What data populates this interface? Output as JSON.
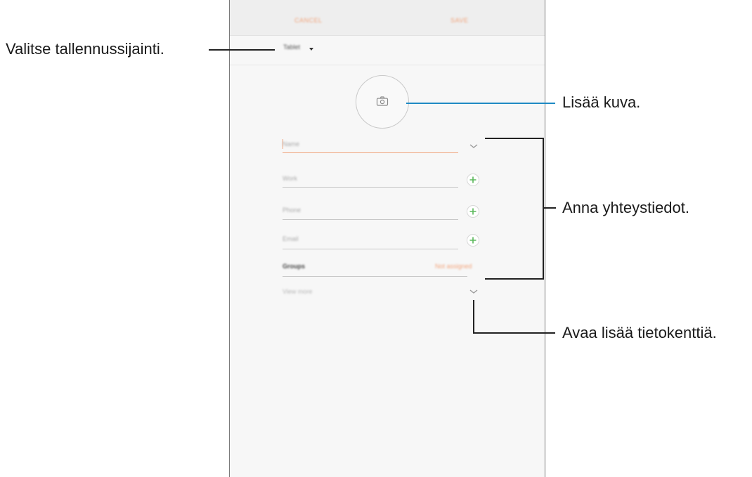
{
  "screen": {
    "top_bar": {
      "cancel_label": "CANCEL",
      "save_label": "SAVE"
    },
    "storage": {
      "label": "Tablet"
    },
    "fields": {
      "name_placeholder": "Name",
      "nickname_placeholder": "Work",
      "phone_placeholder": "Phone",
      "email_placeholder": "Email"
    },
    "groups": {
      "label": "Groups",
      "value": "Not assigned"
    },
    "view_more_label": "View more"
  },
  "callouts": {
    "storage": "Valitse tallennussijainti.",
    "photo": "Lisää kuva.",
    "details": "Anna yhteystiedot.",
    "more_fields": "Avaa lisää tietokenttiä."
  },
  "colors": {
    "accent": "#f0a57e",
    "plus_green": "#5cb85c",
    "callout_line": "#1f8ac4"
  },
  "icons": {
    "photo": "camera-icon",
    "add": "plus-icon",
    "expand": "chevron-down-icon",
    "storage": "caret-down-icon"
  }
}
